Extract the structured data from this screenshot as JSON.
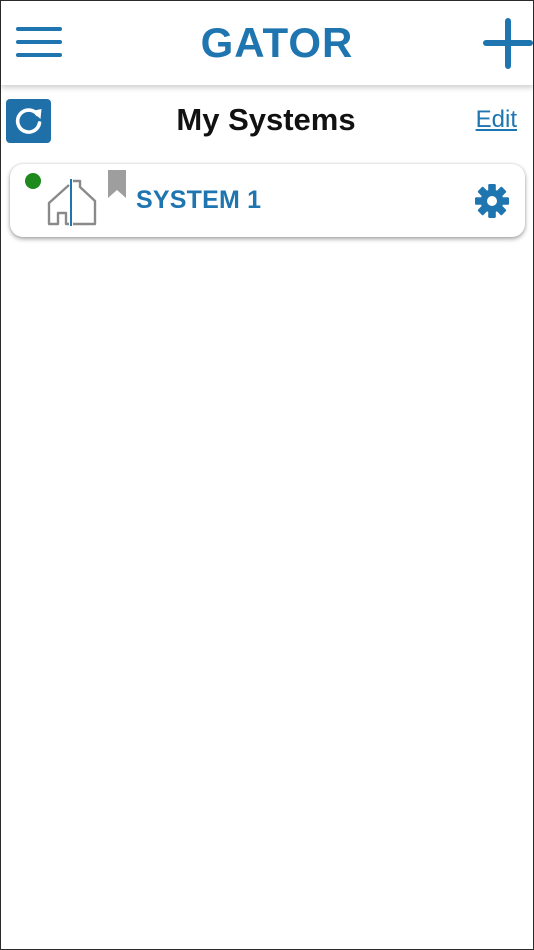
{
  "header": {
    "logo_text": "GATOR",
    "menu_icon": "hamburger-menu-icon",
    "add_icon": "plus-icon"
  },
  "page": {
    "title": "My Systems",
    "edit_label": "Edit",
    "refresh_icon": "refresh-icon"
  },
  "systems": [
    {
      "name": "SYSTEM 1",
      "status": "online",
      "status_color": "#1e8a1e",
      "icon": "house-icon",
      "bookmark_icon": "bookmark-icon",
      "settings_icon": "gear-icon"
    }
  ],
  "colors": {
    "accent": "#1f75b0",
    "refresh_bg": "#1f6fa8",
    "bookmark": "#9e9e9e",
    "house_outline": "#8a8a8a"
  }
}
